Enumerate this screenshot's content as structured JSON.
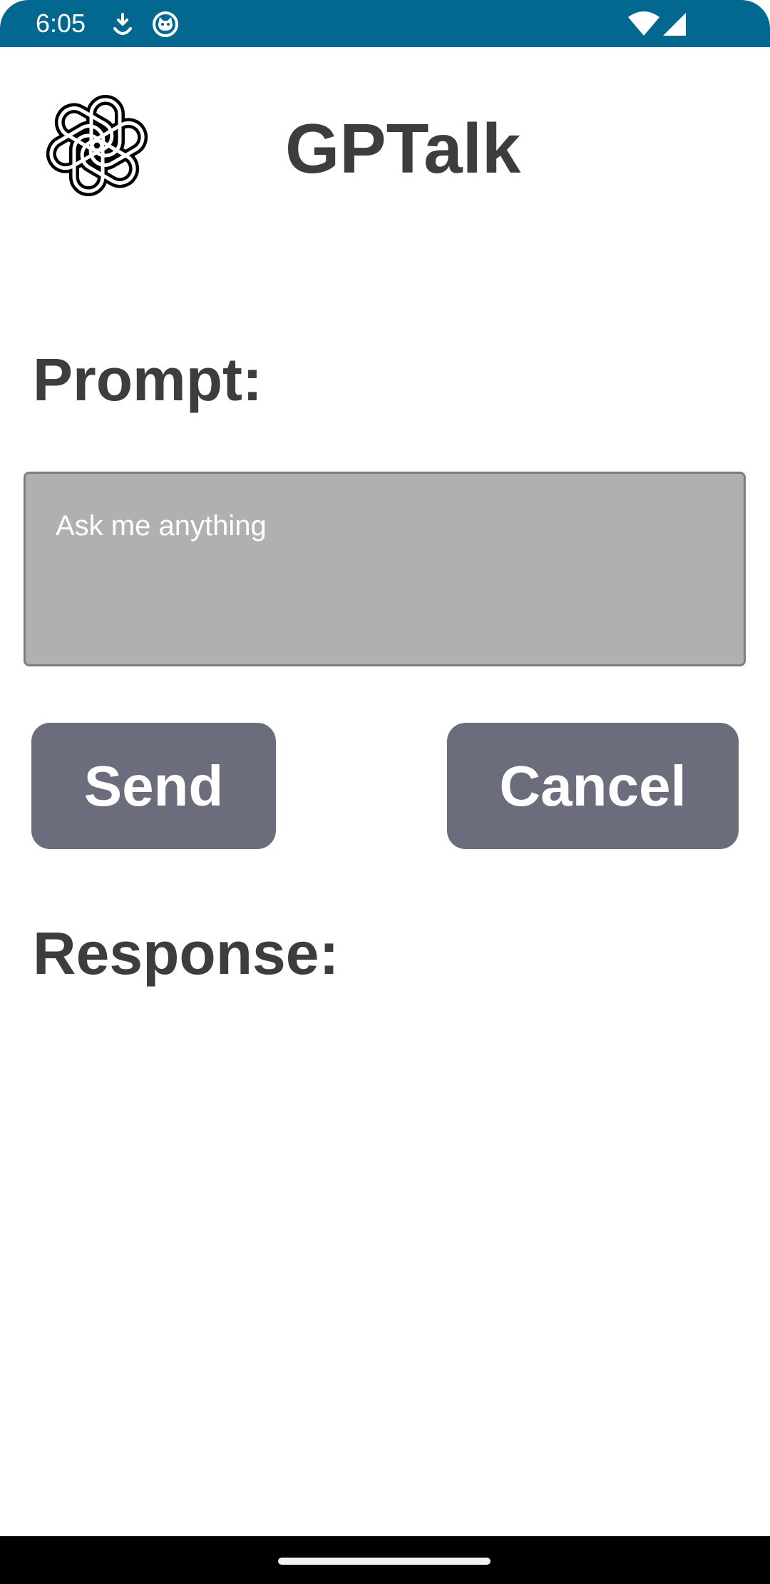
{
  "status_bar": {
    "time": "6:05",
    "background_color": "#02688f",
    "icons": [
      "download-notification-icon",
      "cat-face-notification-icon",
      "wifi-icon",
      "cellular-signal-icon"
    ]
  },
  "header": {
    "logo_icon": "openai-logo-icon",
    "title": "GPTalk"
  },
  "prompt": {
    "label": "Prompt:",
    "placeholder": "Ask me anything",
    "value": ""
  },
  "actions": {
    "send_label": "Send",
    "cancel_label": "Cancel",
    "button_color": "#6b6c7c"
  },
  "response": {
    "label": "Response:",
    "text": ""
  },
  "nav_bar": {
    "handle_icon": "home-gesture-handle"
  }
}
